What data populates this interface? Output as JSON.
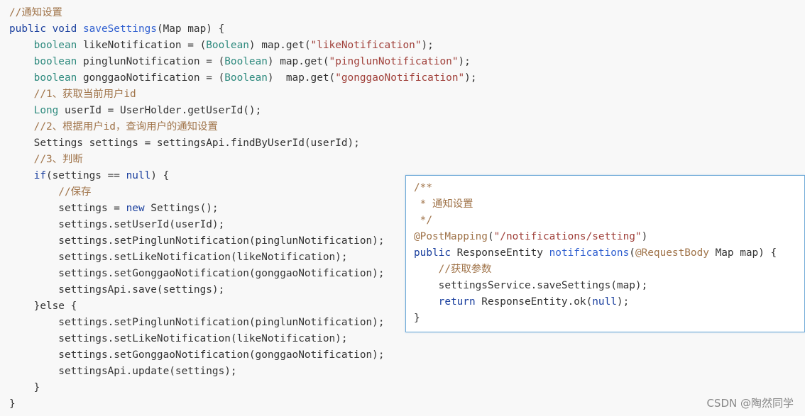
{
  "main_code": {
    "lines": [
      [
        {
          "t": "//通知设置",
          "c": "comment"
        }
      ],
      [
        {
          "t": "public void ",
          "c": "kw"
        },
        {
          "t": "saveSettings",
          "c": "fn"
        },
        {
          "t": "(Map map) {",
          "c": "plain"
        }
      ],
      [
        {
          "t": "    boolean ",
          "c": "type"
        },
        {
          "t": "likeNotification = (",
          "c": "plain"
        },
        {
          "t": "Boolean",
          "c": "type"
        },
        {
          "t": ") map.get(",
          "c": "plain"
        },
        {
          "t": "\"likeNotification\"",
          "c": "str"
        },
        {
          "t": ");",
          "c": "plain"
        }
      ],
      [
        {
          "t": "    boolean ",
          "c": "type"
        },
        {
          "t": "pinglunNotification = (",
          "c": "plain"
        },
        {
          "t": "Boolean",
          "c": "type"
        },
        {
          "t": ") map.get(",
          "c": "plain"
        },
        {
          "t": "\"pinglunNotification\"",
          "c": "str"
        },
        {
          "t": ");",
          "c": "plain"
        }
      ],
      [
        {
          "t": "    boolean ",
          "c": "type"
        },
        {
          "t": "gonggaoNotification = (",
          "c": "plain"
        },
        {
          "t": "Boolean",
          "c": "type"
        },
        {
          "t": ")  map.get(",
          "c": "plain"
        },
        {
          "t": "\"gonggaoNotification\"",
          "c": "str"
        },
        {
          "t": ");",
          "c": "plain"
        }
      ],
      [
        {
          "t": "    //1、获取当前用户id",
          "c": "comment"
        }
      ],
      [
        {
          "t": "    Long ",
          "c": "type"
        },
        {
          "t": "userId = UserHolder.getUserId();",
          "c": "plain"
        }
      ],
      [
        {
          "t": "    //2、根据用户id，查询用户的通知设置",
          "c": "comment"
        }
      ],
      [
        {
          "t": "    Settings settings = settingsApi.findByUserId(userId);",
          "c": "plain"
        }
      ],
      [
        {
          "t": "    //3、判断",
          "c": "comment"
        }
      ],
      [
        {
          "t": "    ",
          "c": "plain"
        },
        {
          "t": "if",
          "c": "kw"
        },
        {
          "t": "(settings == ",
          "c": "plain"
        },
        {
          "t": "null",
          "c": "kw"
        },
        {
          "t": ") {",
          "c": "plain"
        }
      ],
      [
        {
          "t": "        //保存",
          "c": "comment"
        }
      ],
      [
        {
          "t": "        settings = ",
          "c": "plain"
        },
        {
          "t": "new",
          "c": "kw"
        },
        {
          "t": " Settings();",
          "c": "plain"
        }
      ],
      [
        {
          "t": "        settings.setUserId(userId);",
          "c": "plain"
        }
      ],
      [
        {
          "t": "        settings.setPinglunNotification(pinglunNotification);",
          "c": "plain"
        }
      ],
      [
        {
          "t": "        settings.setLikeNotification(likeNotification);",
          "c": "plain"
        }
      ],
      [
        {
          "t": "        settings.setGonggaoNotification(gonggaoNotification);",
          "c": "plain"
        }
      ],
      [
        {
          "t": "        settingsApi.save(settings);",
          "c": "plain"
        }
      ],
      [
        {
          "t": "    }else {",
          "c": "plain"
        }
      ],
      [
        {
          "t": "        settings.setPinglunNotification(pinglunNotification);",
          "c": "plain"
        }
      ],
      [
        {
          "t": "        settings.setLikeNotification(likeNotification);",
          "c": "plain"
        }
      ],
      [
        {
          "t": "        settings.setGonggaoNotification(gonggaoNotification);",
          "c": "plain"
        }
      ],
      [
        {
          "t": "        settingsApi.update(settings);",
          "c": "plain"
        }
      ],
      [
        {
          "t": "    }",
          "c": "plain"
        }
      ],
      [
        {
          "t": "}",
          "c": "plain"
        }
      ]
    ]
  },
  "popup_code": {
    "lines": [
      [
        {
          "t": "/**",
          "c": "comment"
        }
      ],
      [
        {
          "t": " * 通知设置",
          "c": "comment"
        }
      ],
      [
        {
          "t": " */",
          "c": "comment"
        }
      ],
      [
        {
          "t": "@PostMapping",
          "c": "comment"
        },
        {
          "t": "(",
          "c": "plain"
        },
        {
          "t": "\"/notifications/setting\"",
          "c": "str"
        },
        {
          "t": ")",
          "c": "plain"
        }
      ],
      [
        {
          "t": "public ",
          "c": "kw"
        },
        {
          "t": "ResponseEntity ",
          "c": "plain"
        },
        {
          "t": "notifications",
          "c": "fn"
        },
        {
          "t": "(",
          "c": "plain"
        },
        {
          "t": "@RequestBody",
          "c": "comment"
        },
        {
          "t": " Map map) {",
          "c": "plain"
        }
      ],
      [
        {
          "t": "    //获取参数",
          "c": "comment"
        }
      ],
      [
        {
          "t": "    settingsService.saveSettings(map);",
          "c": "plain"
        }
      ],
      [
        {
          "t": "    ",
          "c": "plain"
        },
        {
          "t": "return",
          "c": "kw"
        },
        {
          "t": " ResponseEntity.ok(",
          "c": "plain"
        },
        {
          "t": "null",
          "c": "kw"
        },
        {
          "t": ");",
          "c": "plain"
        }
      ],
      [
        {
          "t": "}",
          "c": "plain"
        }
      ]
    ]
  },
  "watermark": "CSDN @陶然同学"
}
